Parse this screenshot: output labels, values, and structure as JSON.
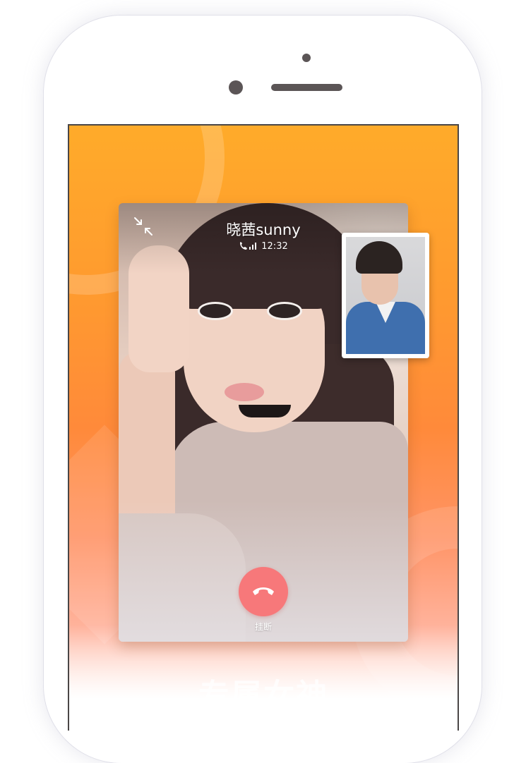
{
  "call": {
    "caller_name": "晓茜sunny",
    "signal_icon": "phone-signal-icon",
    "duration": "12:32",
    "hangup_label": "挂断",
    "hangup_color": "#f7787a"
  },
  "banner": {
    "slogan": "专属女神"
  },
  "colors": {
    "background_top": "#ffab2a",
    "background_mid": "#ff8a3a",
    "background_bottom": "#ffffff"
  }
}
